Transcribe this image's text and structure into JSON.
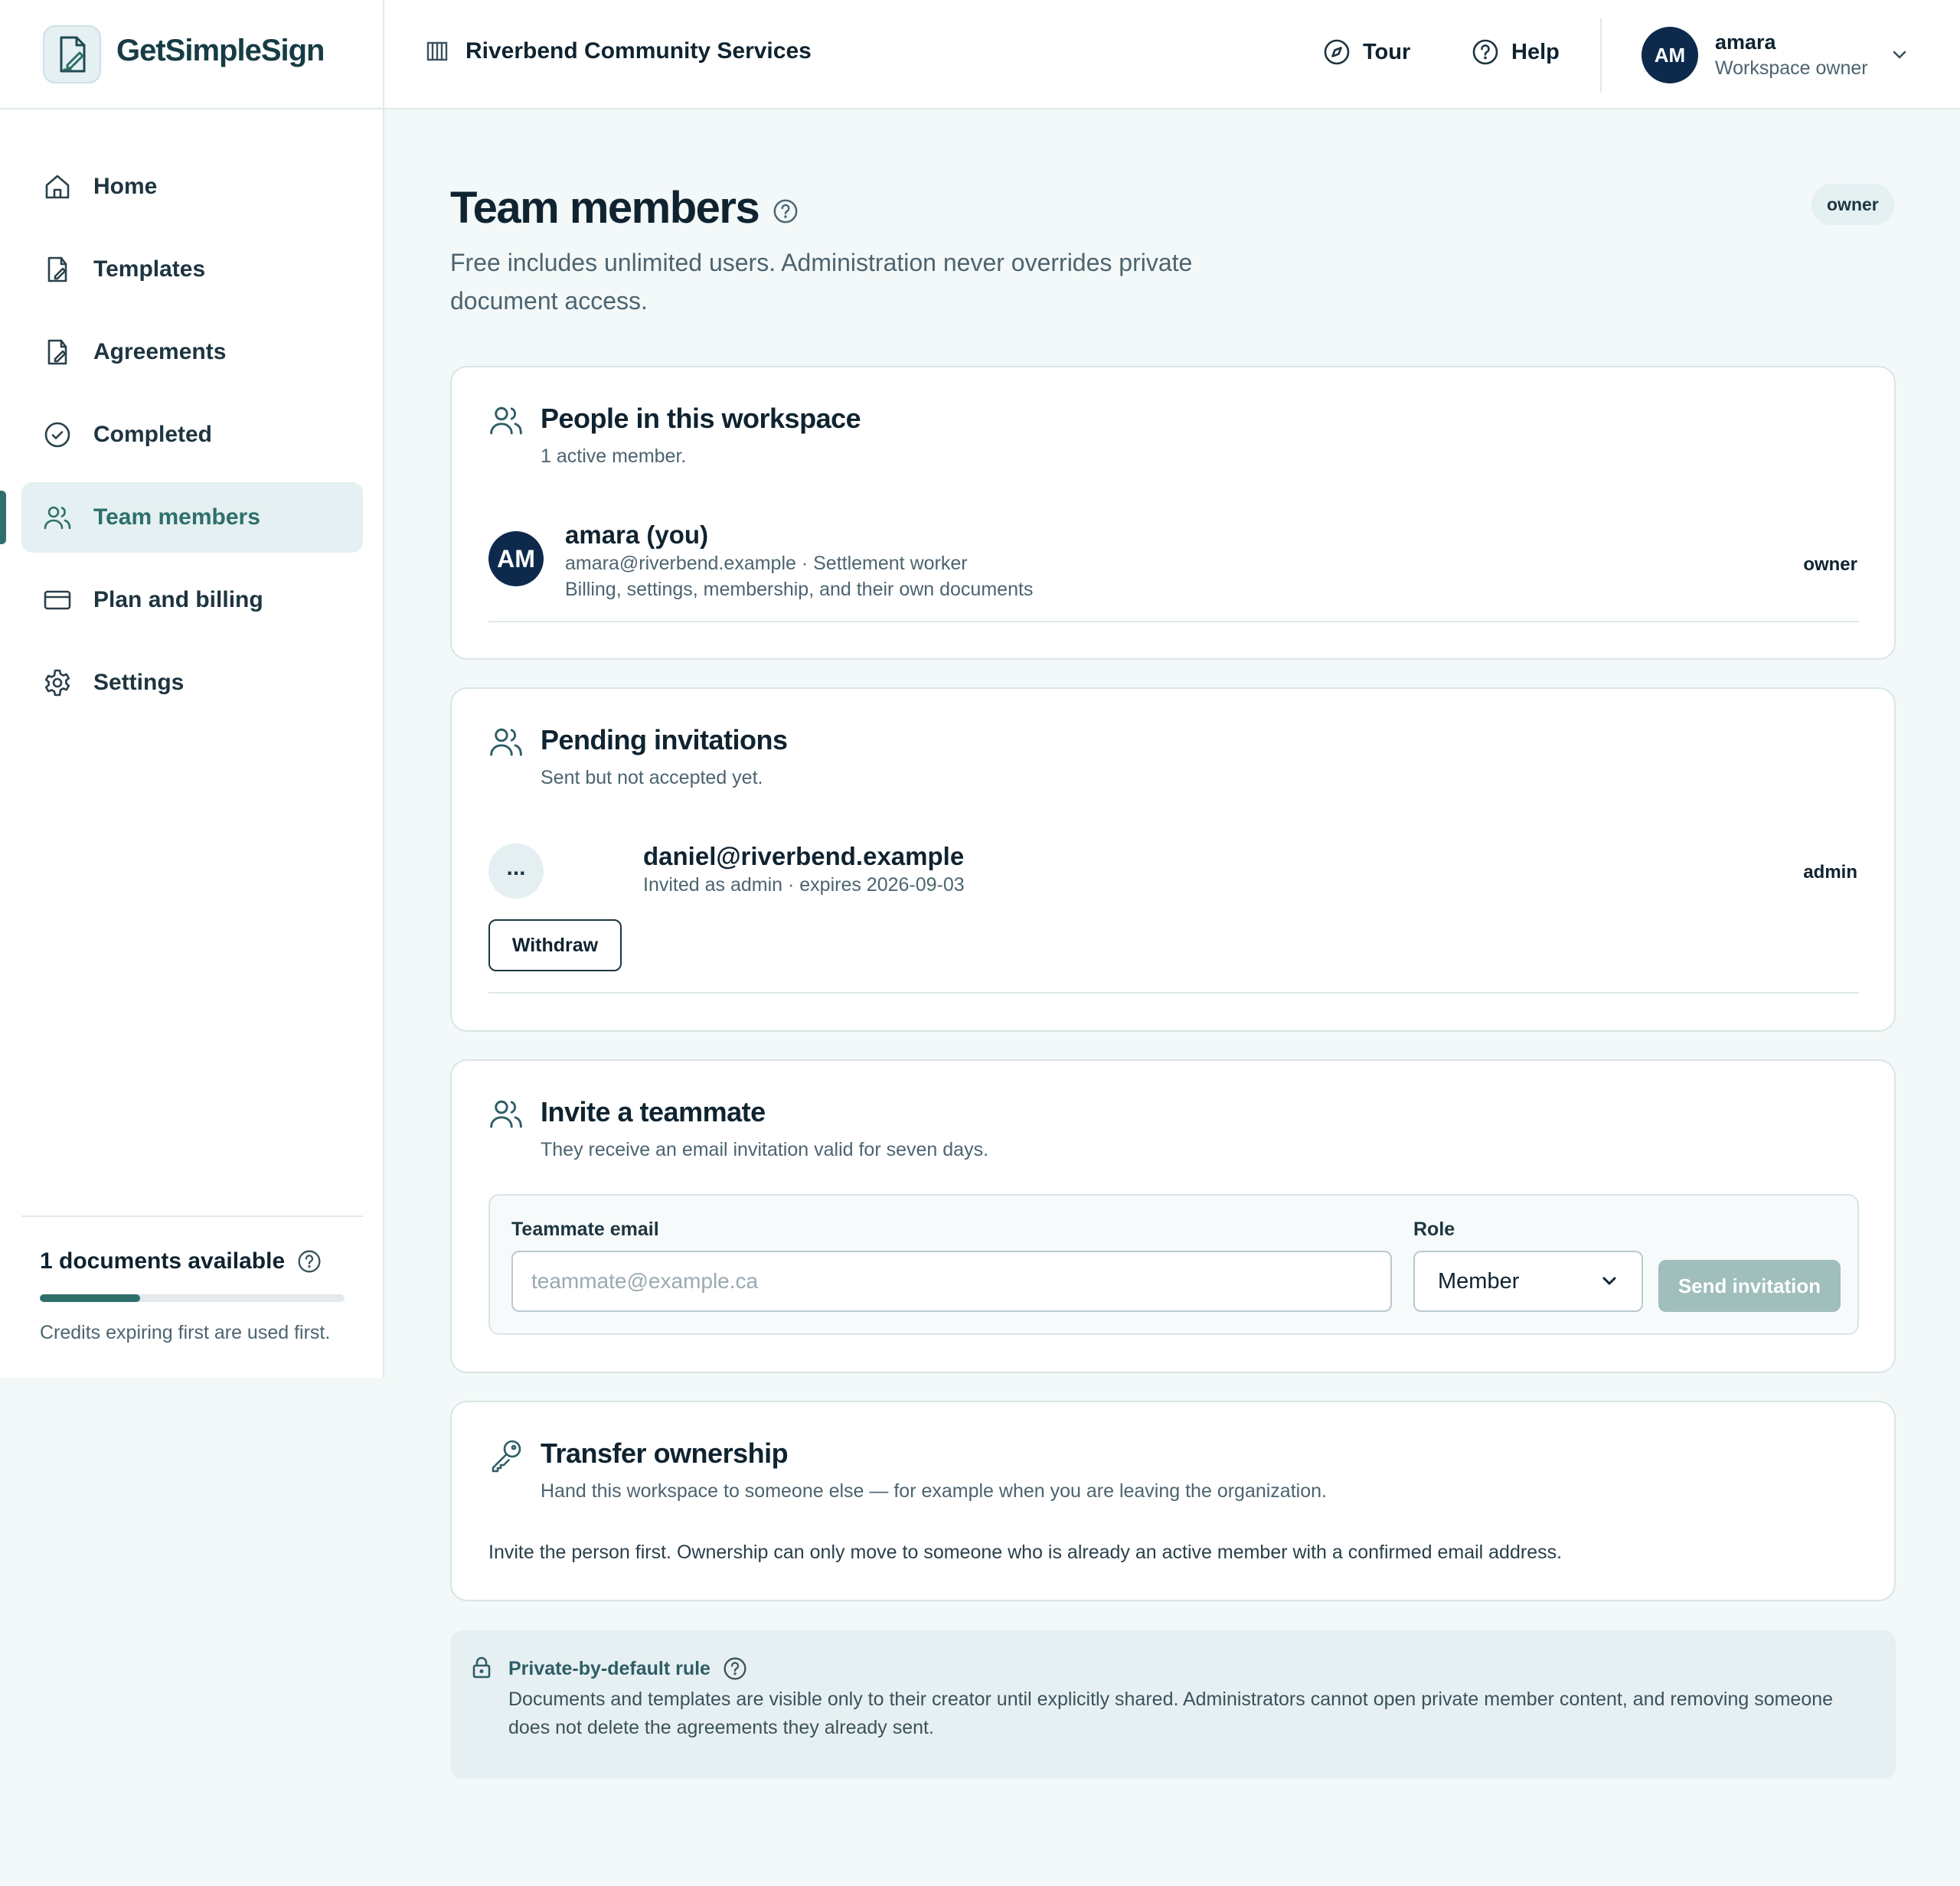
{
  "app": {
    "name": "GetSimpleSign"
  },
  "header": {
    "org_name": "Riverbend Community Services",
    "tour_label": "Tour",
    "help_label": "Help",
    "user": {
      "initials": "AM",
      "name": "amara",
      "role": "Workspace owner"
    }
  },
  "sidebar": {
    "items": [
      {
        "label": "Home",
        "icon": "home-icon"
      },
      {
        "label": "Templates",
        "icon": "template-edit-icon"
      },
      {
        "label": "Agreements",
        "icon": "document-edit-icon"
      },
      {
        "label": "Completed",
        "icon": "check-circle-icon"
      },
      {
        "label": "Team members",
        "icon": "users-icon",
        "active": true
      },
      {
        "label": "Plan and billing",
        "icon": "credit-card-icon"
      },
      {
        "label": "Settings",
        "icon": "gear-icon"
      }
    ],
    "credits": {
      "title": "1 documents available",
      "progress_percent": 33,
      "note": "Credits expiring first are used first."
    }
  },
  "page": {
    "title": "Team members",
    "role_badge": "owner",
    "subtitle": "Free includes unlimited users. Administration never overrides private document access."
  },
  "people": {
    "title": "People in this workspace",
    "subtitle": "1 active member.",
    "members": [
      {
        "initials": "AM",
        "name": "amara (you)",
        "meta": "amara@riverbend.example · Settlement worker",
        "permissions": "Billing, settings, membership, and their own documents",
        "role": "owner"
      }
    ]
  },
  "pending": {
    "title": "Pending invitations",
    "subtitle": "Sent but not accepted yet.",
    "invitations": [
      {
        "avatar": "...",
        "email": "daniel@riverbend.example",
        "meta": "Invited as admin · expires 2026-09-03",
        "role": "admin",
        "withdraw_label": "Withdraw"
      }
    ]
  },
  "invite": {
    "title": "Invite a teammate",
    "subtitle": "They receive an email invitation valid for seven days.",
    "email_label": "Teammate email",
    "email_placeholder": "teammate@example.ca",
    "email_value": "",
    "role_label": "Role",
    "role_value": "Member",
    "send_label": "Send invitation"
  },
  "transfer": {
    "title": "Transfer ownership",
    "subtitle": "Hand this workspace to someone else — for example when you are leaving the organization.",
    "note": "Invite the person first. Ownership can only move to someone who is already an active member with a confirmed email address."
  },
  "rule": {
    "title": "Private-by-default rule",
    "text": "Documents and templates are visible only to their creator until explicitly shared. Administrators cannot open private member content, and removing someone does not delete the agreements they already sent."
  },
  "colors": {
    "accent": "#2f6e6b",
    "navy": "#0d2a4d",
    "background": "#f3f8f8",
    "disabled_button": "#9fbebc"
  }
}
